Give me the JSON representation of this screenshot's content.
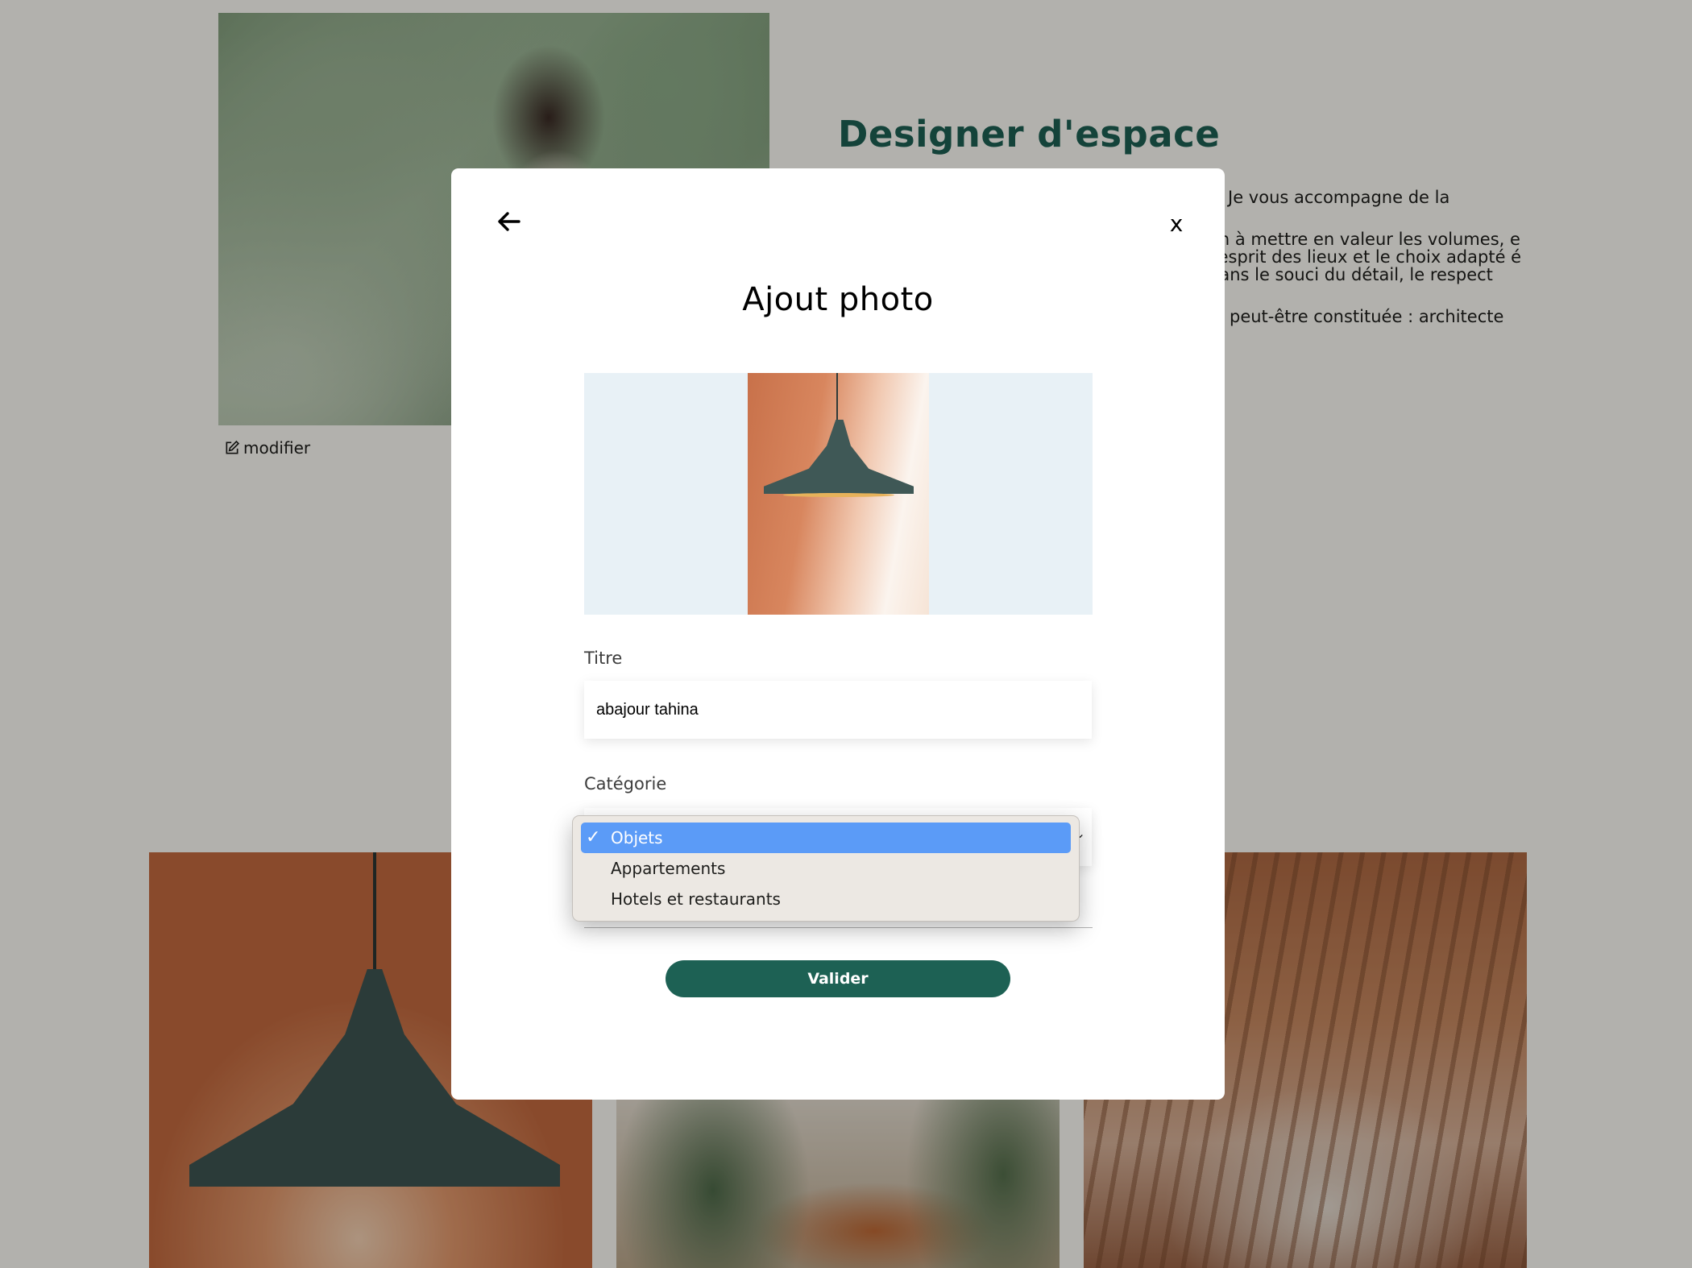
{
  "background": {
    "section_heading": "Designer d'espace",
    "paragraphs": [
      "Je vous accompagne de la",
      "on à mettre en valeur les volumes, e l'esprit des lieux et le choix adapté é dans le souci du détail, le respect",
      "peut-être constituée : architecte"
    ],
    "edit_link": "modifier"
  },
  "modal": {
    "title": "Ajout photo",
    "close_label": "x",
    "title_field": {
      "label": "Titre",
      "value": "abajour tahina"
    },
    "category_field": {
      "label": "Catégorie",
      "selected": "Objets",
      "options": [
        "Objets",
        "Appartements",
        "Hotels et restaurants"
      ]
    },
    "submit_label": "Valider"
  },
  "colors": {
    "primary": "#1d6154",
    "dropdown_highlight": "#5b9bf7"
  },
  "icons": {
    "back": "arrow-left-icon",
    "close": "close-icon",
    "edit": "edit-icon",
    "check": "check-icon"
  }
}
